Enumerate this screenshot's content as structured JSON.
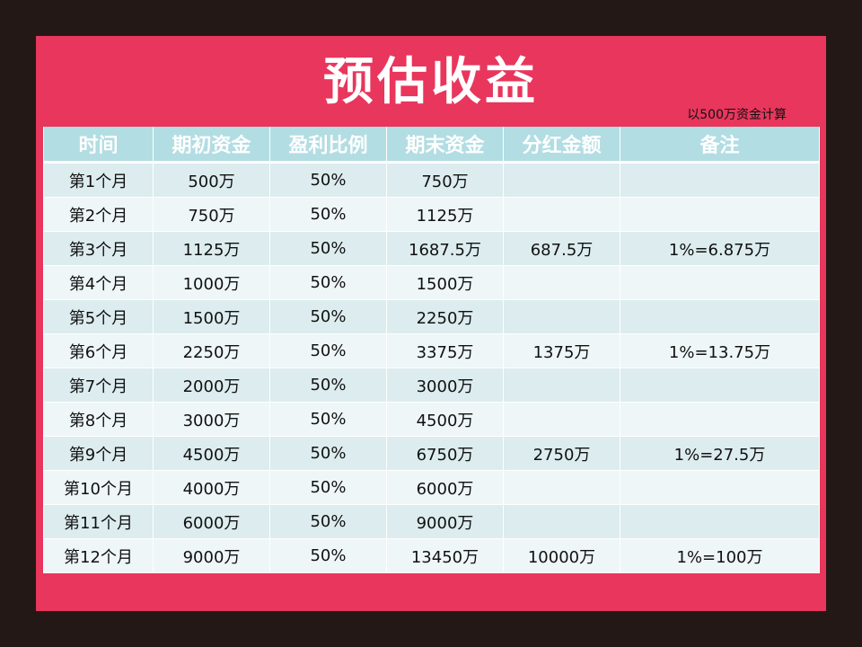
{
  "title": "预估收益",
  "note": "以500万资金计算",
  "table": {
    "headers": [
      "时间",
      "期初资金",
      "盈利比例",
      "期末资金",
      "分红金额",
      "备注"
    ],
    "rows": [
      [
        "第1个月",
        "500万",
        "50%",
        "750万",
        "",
        ""
      ],
      [
        "第2个月",
        "750万",
        "50%",
        "1125万",
        "",
        ""
      ],
      [
        "第3个月",
        "1125万",
        "50%",
        "1687.5万",
        "687.5万",
        "1%=6.875万"
      ],
      [
        "第4个月",
        "1000万",
        "50%",
        "1500万",
        "",
        ""
      ],
      [
        "第5个月",
        "1500万",
        "50%",
        "2250万",
        "",
        ""
      ],
      [
        "第6个月",
        "2250万",
        "50%",
        "3375万",
        "1375万",
        "1%=13.75万"
      ],
      [
        "第7个月",
        "2000万",
        "50%",
        "3000万",
        "",
        ""
      ],
      [
        "第8个月",
        "3000万",
        "50%",
        "4500万",
        "",
        ""
      ],
      [
        "第9个月",
        "4500万",
        "50%",
        "6750万",
        "2750万",
        "1%=27.5万"
      ],
      [
        "第10个月",
        "4000万",
        "50%",
        "6000万",
        "",
        ""
      ],
      [
        "第11个月",
        "6000万",
        "50%",
        "9000万",
        "",
        ""
      ],
      [
        "第12个月",
        "9000万",
        "50%",
        "13450万",
        "10000万",
        "1%=100万"
      ]
    ]
  },
  "colors": {
    "background": "#231815",
    "panel": "#e8365c",
    "header": "#b2dde3",
    "row_odd": "#dcecef",
    "row_even": "#eef6f7"
  }
}
